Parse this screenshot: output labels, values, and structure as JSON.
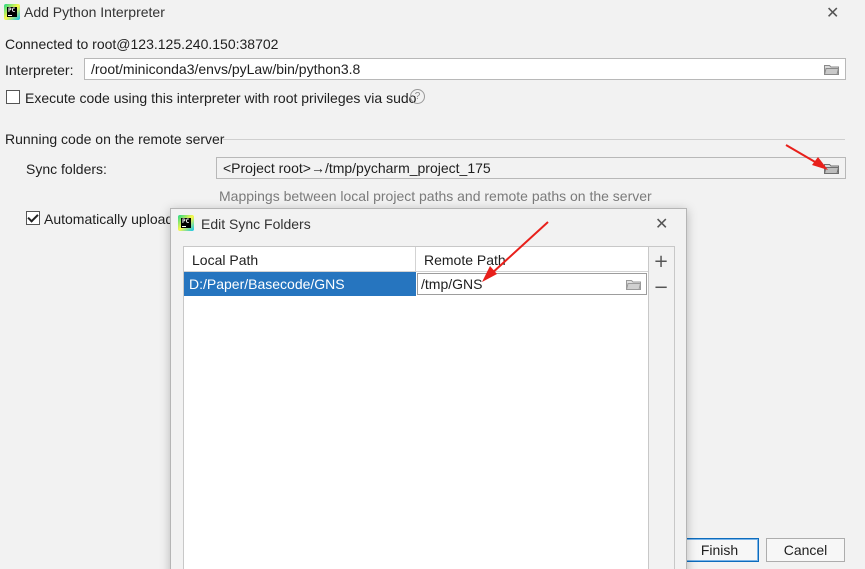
{
  "window": {
    "title": "Add Python Interpreter",
    "close_glyph": "✕",
    "logo_text": "PC"
  },
  "connection": {
    "text": "Connected to root@123.125.240.150:38702"
  },
  "interpreter": {
    "label": "Interpreter:",
    "value": "/root/miniconda3/envs/pyLaw/bin/python3.8",
    "browse_icon": "folder-icon"
  },
  "sudo": {
    "label": "Execute code using this interpreter with root privileges via sudo",
    "checked": false,
    "help_glyph": "?"
  },
  "remote_section": {
    "title": "Running code on the remote server",
    "sync_folders_label": "Sync folders:",
    "sync_folders_value": "<Project root>→/tmp/pycharm_project_175",
    "sync_hint": "Mappings between local project paths and remote paths on the server",
    "auto_upload_label": "Automatically upload",
    "auto_upload_checked": true
  },
  "buttons": {
    "finish": "Finish",
    "cancel": "Cancel"
  },
  "edit_sync_dialog": {
    "title": "Edit Sync Folders",
    "close_glyph": "✕",
    "columns": [
      "Local Path",
      "Remote Path"
    ],
    "rows": [
      {
        "local": "D:/Paper/Basecode/GNS",
        "remote": "/tmp/GNS"
      }
    ],
    "add_glyph": "+",
    "remove_glyph": "−"
  },
  "colors": {
    "selection": "#2675bf",
    "annotation_arrow": "#e8201b",
    "background": "#f2f2f2"
  }
}
